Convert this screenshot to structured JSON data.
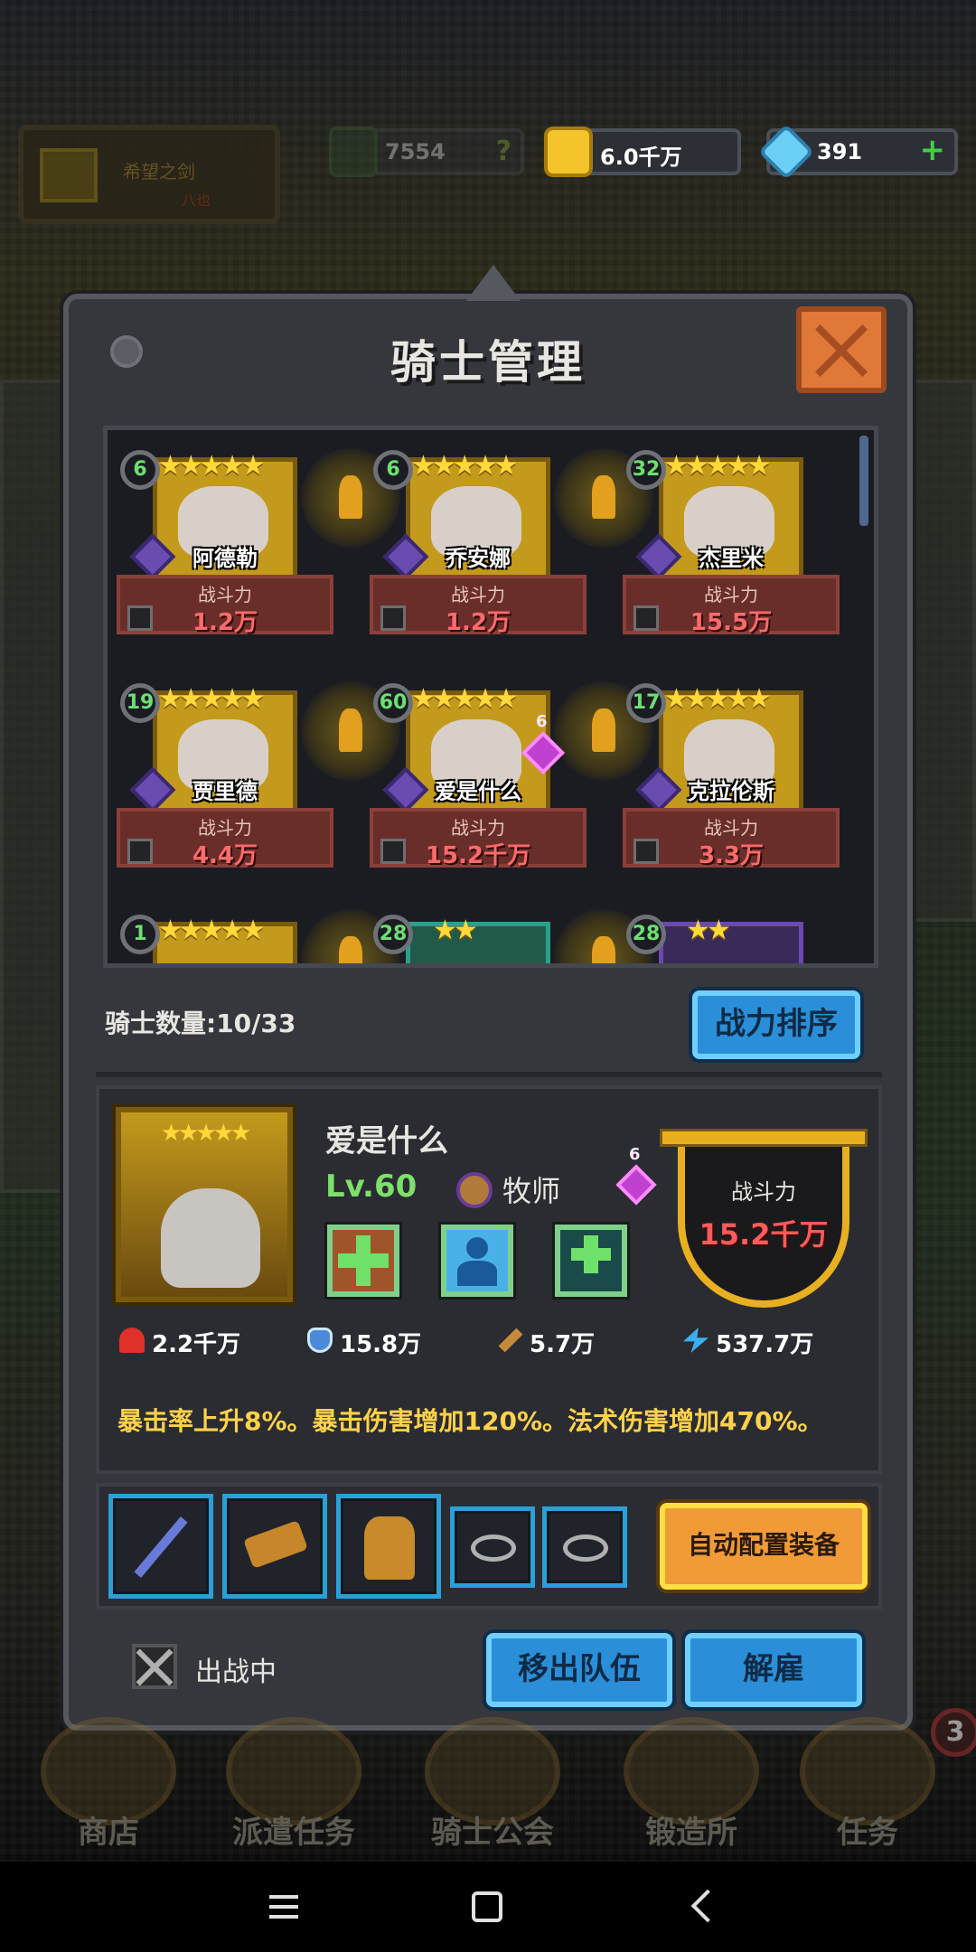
{
  "colors": {
    "accent_blue": "#2a8fd8",
    "accent_orange": "#f09a38",
    "power_red": "#ff5a5a",
    "level_green": "#6be070",
    "star_gold": "#ffd83a"
  },
  "topbar": {
    "guild_name": "希望之剑",
    "guild_sub": "八也",
    "tokens": "7554",
    "tokens_help": "?",
    "gold": "6.0千万",
    "gems": "391",
    "gems_add": "+"
  },
  "panel": {
    "title": "骑士管理",
    "knights": [
      {
        "level": "6",
        "stars": "★★★★★",
        "name": "阿德勒",
        "power_label": "战斗力",
        "power": "1.2万"
      },
      {
        "level": "6",
        "stars": "★★★★★",
        "name": "乔安娜",
        "power_label": "战斗力",
        "power": "1.2万"
      },
      {
        "level": "32",
        "stars": "★★★★★",
        "name": "杰里米",
        "power_label": "战斗力",
        "power": "15.5万"
      },
      {
        "level": "19",
        "stars": "★★★★★",
        "name": "贾里德",
        "power_label": "战斗力",
        "power": "4.4万"
      },
      {
        "level": "60",
        "stars": "★★★★★",
        "name": "爱是什么",
        "power_label": "战斗力",
        "power": "15.2千万",
        "gem": "6"
      },
      {
        "level": "17",
        "stars": "★★★★★",
        "name": "克拉伦斯",
        "power_label": "战斗力",
        "power": "3.3万"
      },
      {
        "level": "1",
        "stars": "★★★★★"
      },
      {
        "level": "28",
        "stars": "★★"
      },
      {
        "level": "28",
        "stars": "★★"
      }
    ],
    "knight_count_label": "骑士数量:10/33",
    "sort_button": "战力排序"
  },
  "detail": {
    "stars": "★★★★★",
    "name": "爱是什么",
    "level": "Lv.60",
    "class": "牧师",
    "gem": "6",
    "power_label": "战斗力",
    "power": "15.2千万",
    "stats": {
      "hp": "2.2千万",
      "mp": "15.8万",
      "atk": "5.7万",
      "spd": "537.7万"
    },
    "description": "暴击率上升8%。暴击伤害增加120%。法术伤害增加470%。"
  },
  "equipment": {
    "auto_button": "自动配置装备"
  },
  "footer": {
    "status": "出战中",
    "remove_button": "移出队伍",
    "dismiss_button": "解雇"
  },
  "game_nav": [
    "商店",
    "派遣任务",
    "骑士公会",
    "锻造所",
    "任务"
  ],
  "game_nav_badge": "3"
}
